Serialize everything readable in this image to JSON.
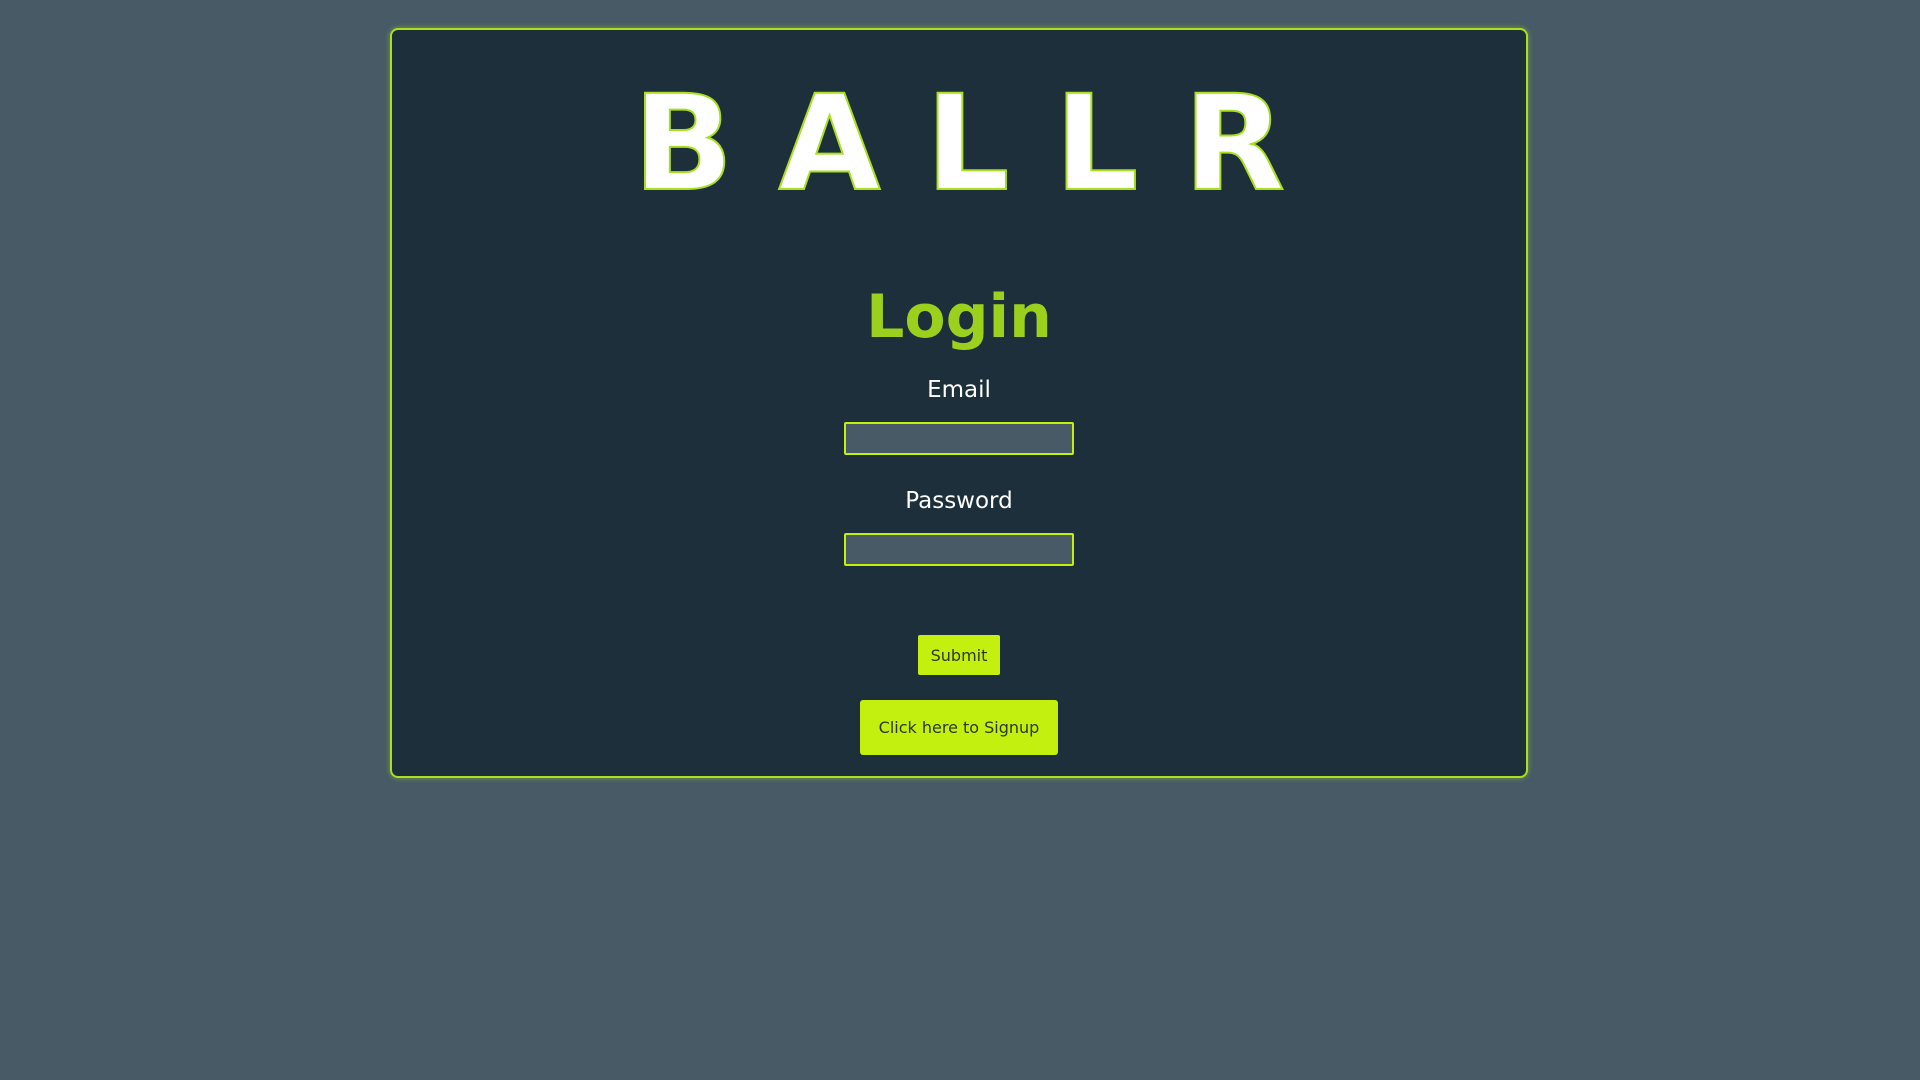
{
  "app": {
    "logo_text": "BALLR"
  },
  "login": {
    "title": "Login",
    "email_label": "Email",
    "email_value": "",
    "password_label": "Password",
    "password_value": "",
    "submit_label": "Submit",
    "signup_label": "Click here to Signup"
  },
  "colors": {
    "page_background": "#475a66",
    "card_background": "#1c2f3b",
    "accent": "#c3f00f",
    "title_green": "#9bd11d"
  }
}
